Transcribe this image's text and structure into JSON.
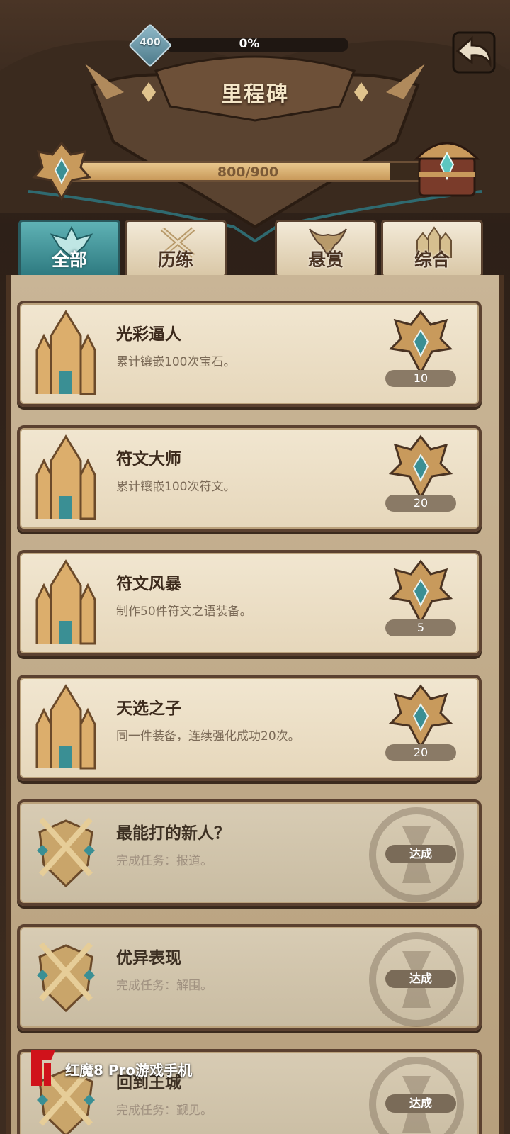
{
  "top": {
    "gem_value": "400",
    "percent_text": "0%",
    "progress_fraction": 0.0
  },
  "header": {
    "title": "里程碑",
    "progress_text": "800/900",
    "progress_fraction": 0.889
  },
  "tabs": [
    {
      "label": "全部",
      "icon": "winged-crest-icon",
      "active": true
    },
    {
      "label": "历练",
      "icon": "crossed-swords-icon",
      "active": false
    },
    {
      "label": "悬赏",
      "icon": "horned-helmet-icon",
      "active": false
    },
    {
      "label": "综合",
      "icon": "castle-icon",
      "active": false
    }
  ],
  "milestones": [
    {
      "title": "光彩逼人",
      "desc": "累计镶嵌100次宝石。",
      "reward": "10",
      "status": "reward",
      "icon": "castle-icon"
    },
    {
      "title": "符文大师",
      "desc": "累计镶嵌100次符文。",
      "reward": "20",
      "status": "reward",
      "icon": "castle-icon"
    },
    {
      "title": "符文风暴",
      "desc": "制作50件符文之语装备。",
      "reward": "5",
      "status": "reward",
      "icon": "castle-icon"
    },
    {
      "title": "天选之子",
      "desc": "同一件装备，连续强化成功20次。",
      "reward": "20",
      "status": "reward",
      "icon": "castle-icon"
    },
    {
      "title": "最能打的新人？",
      "desc": "完成任务：报道。",
      "reward": "达成",
      "status": "done",
      "icon": "crossed-swords-shield-icon"
    },
    {
      "title": "优异表现",
      "desc": "完成任务：解围。",
      "reward": "达成",
      "status": "done",
      "icon": "crossed-swords-shield-icon"
    },
    {
      "title": "回到王城",
      "desc": "完成任务：觐见。",
      "reward": "达成",
      "status": "done",
      "icon": "crossed-swords-shield-icon"
    }
  ],
  "watermark": {
    "text": "红魔8 Pro游戏手机"
  },
  "colors": {
    "accent_teal": "#3a8f94",
    "parchment": "#efe3cc",
    "wood": "#5b4130"
  }
}
